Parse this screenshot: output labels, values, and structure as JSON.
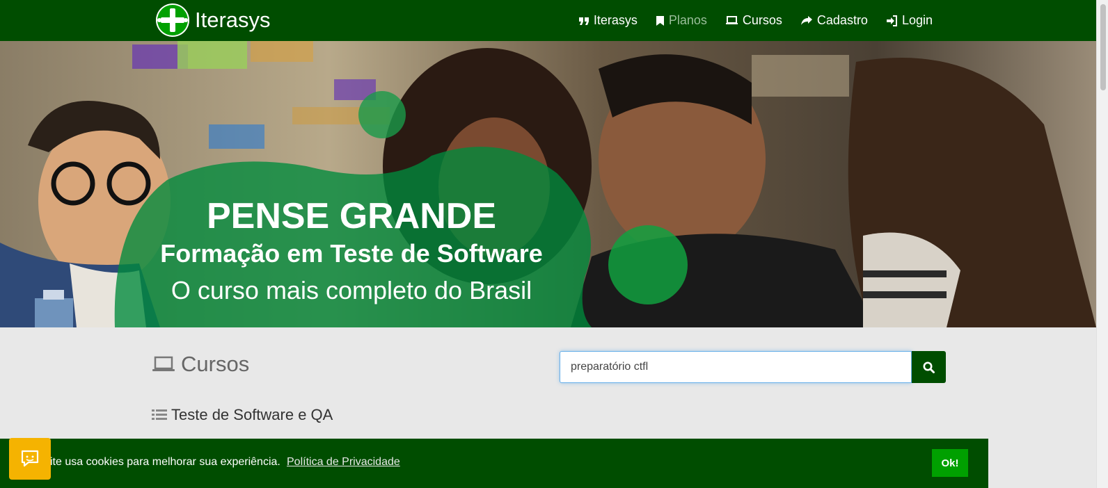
{
  "brand": {
    "name": "Iterasys"
  },
  "nav": [
    {
      "label": "Iterasys",
      "icon": "quote-icon",
      "active": false
    },
    {
      "label": "Planos",
      "icon": "bookmark-icon",
      "active": true
    },
    {
      "label": "Cursos",
      "icon": "laptop-icon",
      "active": false
    },
    {
      "label": "Cadastro",
      "icon": "share-icon",
      "active": false
    },
    {
      "label": "Login",
      "icon": "sign-in-icon",
      "active": false
    }
  ],
  "hero": {
    "title": "PENSE GRANDE",
    "subtitle": "Formação em Teste de Software",
    "tagline": "O curso mais completo do Brasil"
  },
  "courses": {
    "heading": "Cursos",
    "search_value": "preparatório ctfl",
    "category": "Teste de Software e QA"
  },
  "cookie": {
    "text": "ite usa cookies para melhorar sua experiência.",
    "link": "Política de Privacidade",
    "ok_label": "Ok!"
  },
  "colors": {
    "nav_bg": "#004d00",
    "accent_green": "#00a000",
    "chat_yellow": "#f5b301",
    "page_bg": "#e8e8e8"
  }
}
